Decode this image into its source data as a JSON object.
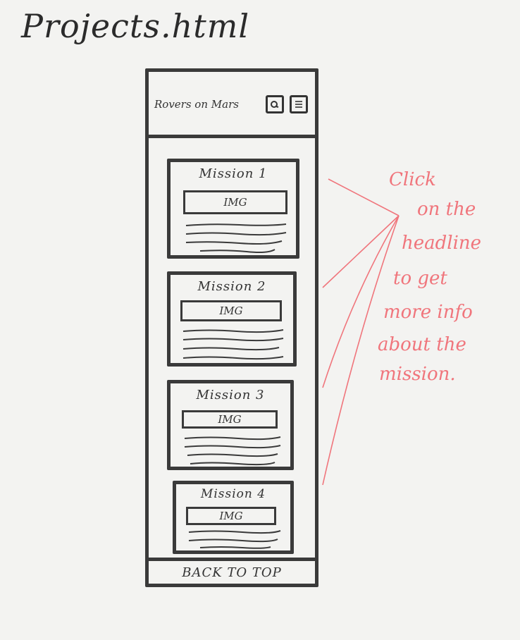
{
  "title": "Projects.html",
  "site_title": "Rovers on Mars",
  "header_icons": [
    "search-icon",
    "menu-icon"
  ],
  "missions": [
    {
      "title": "Mission 1",
      "image_label": "IMG"
    },
    {
      "title": "Mission 2",
      "image_label": "IMG"
    },
    {
      "title": "Mission 3",
      "image_label": "IMG"
    },
    {
      "title": "Mission 4",
      "image_label": "IMG"
    }
  ],
  "footer": {
    "label": "BACK TO TOP"
  },
  "annotation": {
    "lines": [
      "Click",
      "on the",
      "headline",
      "to get",
      "more info",
      "about the",
      "mission."
    ]
  },
  "colors": {
    "ink": "#3a3a3a",
    "annotation": "#f0757c",
    "paper": "#f3f3f1"
  }
}
